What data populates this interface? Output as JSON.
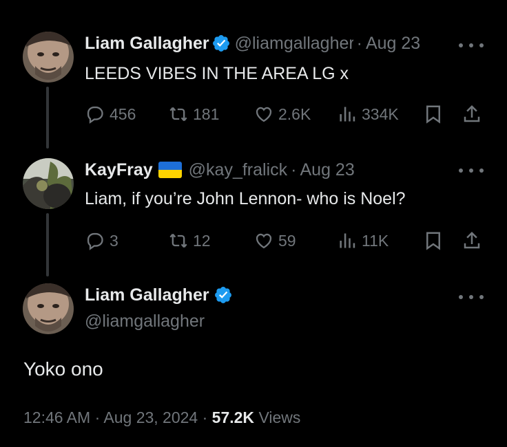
{
  "tweets": [
    {
      "name": "Liam Gallagher",
      "handle": "@liamgallagher",
      "date": "Aug 23",
      "text": "LEEDS VIBES IN THE AREA LG x",
      "replies": "456",
      "reposts": "181",
      "likes": "2.6K",
      "views": "334K",
      "verified": true
    },
    {
      "name": "KayFray",
      "flag": "ukraine-flag",
      "handle": "@kay_fralick",
      "date": "Aug 23",
      "text": "Liam, if you’re John Lennon- who is Noel?",
      "replies": "3",
      "reposts": "12",
      "likes": "59",
      "views": "11K"
    }
  ],
  "focused": {
    "name": "Liam Gallagher",
    "handle": "@liamgallagher",
    "text": "Yoko ono",
    "time": "12:46 AM",
    "date": "Aug 23, 2024",
    "views_count": "57.2K",
    "views_label": "Views",
    "separator": "·",
    "verified": true
  },
  "colors": {
    "background": "#000000",
    "primary_text": "#e7e9ea",
    "secondary_text": "#71767b",
    "verified_badge": "#1d9bf0",
    "thread_line": "#333639"
  },
  "icons": [
    "reply-icon",
    "repost-icon",
    "like-icon",
    "views-icon",
    "bookmark-icon",
    "share-icon",
    "more-icon",
    "verified-icon"
  ]
}
